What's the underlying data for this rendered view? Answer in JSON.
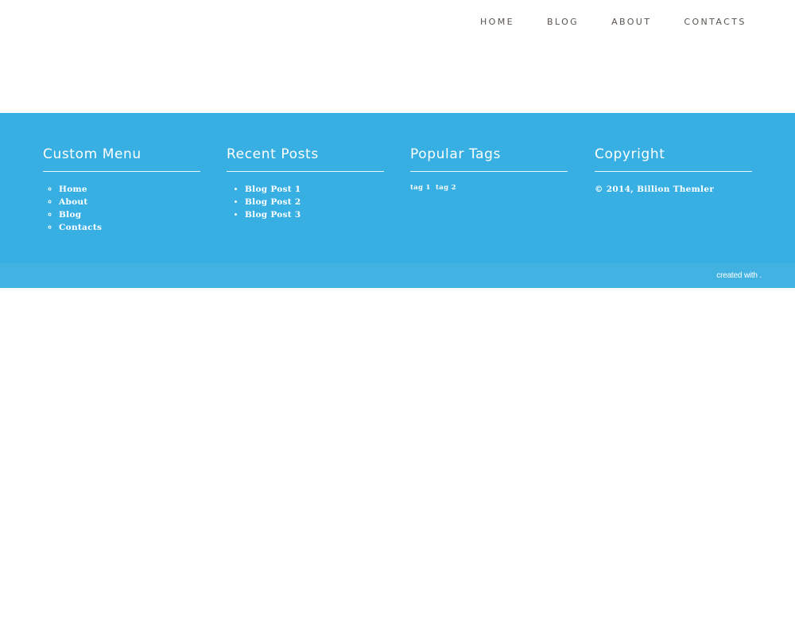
{
  "nav": {
    "items": [
      {
        "label": "HOME"
      },
      {
        "label": "BLOG"
      },
      {
        "label": "ABOUT"
      },
      {
        "label": "CONTACTS"
      }
    ]
  },
  "footer": {
    "custom_menu": {
      "title": "Custom Menu",
      "items": [
        {
          "label": "Home"
        },
        {
          "label": "About"
        },
        {
          "label": "Blog"
        },
        {
          "label": "Contacts"
        }
      ]
    },
    "recent_posts": {
      "title": "Recent Posts",
      "items": [
        {
          "label": "Blog Post 1"
        },
        {
          "label": "Blog Post 2"
        },
        {
          "label": "Blog Post 3"
        }
      ]
    },
    "popular_tags": {
      "title": "Popular Tags",
      "tags": [
        {
          "label": "tag 1"
        },
        {
          "label": "tag 2"
        }
      ]
    },
    "copyright": {
      "title": "Copyright",
      "text": "© 2014, Billion Themler"
    }
  },
  "credits": {
    "prefix": "",
    "created_with": "created with",
    "suffix": "."
  },
  "colors": {
    "footer_bg": "#37afe3",
    "bottombar_bg": "#41b2e2",
    "nav_text": "#5a5550"
  }
}
